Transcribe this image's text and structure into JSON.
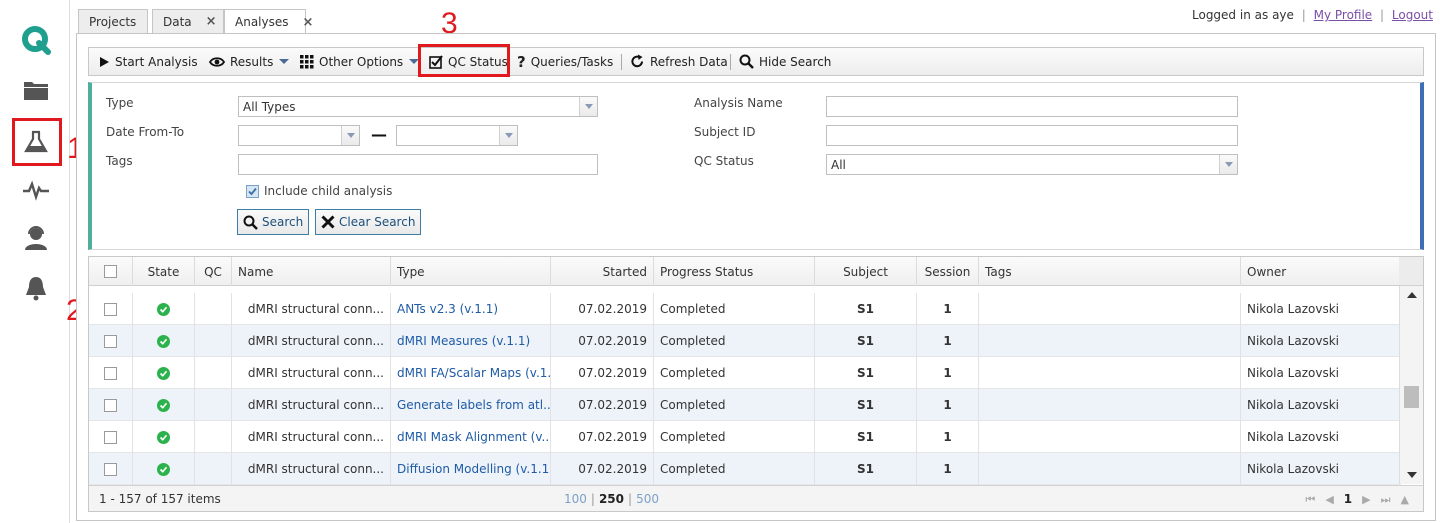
{
  "sidebar": {
    "items": [
      {
        "name": "logo",
        "icon": "q-logo-icon"
      },
      {
        "name": "projects",
        "icon": "folder-icon"
      },
      {
        "name": "analyses",
        "icon": "flask-icon"
      },
      {
        "name": "activity",
        "icon": "pulse-icon"
      },
      {
        "name": "support",
        "icon": "headset-user-icon"
      },
      {
        "name": "notifications",
        "icon": "bell-icon"
      }
    ],
    "accent": "#1fa08e"
  },
  "annotations": [
    "1",
    "2",
    "3"
  ],
  "tabs": [
    {
      "label": "Projects",
      "closable": false
    },
    {
      "label": "Data",
      "closable": true,
      "close": "×"
    },
    {
      "label": "Analyses",
      "closable": true,
      "close": "×",
      "active": true
    }
  ],
  "header": {
    "logged_in_as": "Logged in as",
    "user": "aye",
    "sep": "|",
    "my_profile": "My Profile",
    "logout": "Logout"
  },
  "toolbar": {
    "start_analysis": "Start Analysis",
    "results": "Results",
    "other_options": "Other Options",
    "qc_status": "QC Status",
    "queries_tasks": "Queries/Tasks",
    "refresh_data": "Refresh Data",
    "hide_search": "Hide Search"
  },
  "search": {
    "type_label": "Type",
    "type_value": "All Types",
    "date_label": "Date From-To",
    "date_dash": "—",
    "tags_label": "Tags",
    "include_child": "Include child analysis",
    "include_child_checked": true,
    "analysis_name_label": "Analysis Name",
    "subject_id_label": "Subject ID",
    "qc_status_label": "QC Status",
    "qc_status_value": "All",
    "search_button": "Search",
    "clear_button": "Clear Search"
  },
  "grid": {
    "columns": [
      "State",
      "QC",
      "Name",
      "Type",
      "Started",
      "Progress Status",
      "Subject",
      "Session",
      "Tags",
      "Owner"
    ],
    "rows": [
      {
        "name": "dMRI structural conn...",
        "type": "ANTs v2.3 (v.1.1)",
        "started": "07.02.2019",
        "progress": "Completed",
        "subject": "S1",
        "session": "1",
        "tags": "",
        "owner": "Nikola Lazovski"
      },
      {
        "name": "dMRI structural conn...",
        "type": "dMRI Measures (v.1.1)",
        "started": "07.02.2019",
        "progress": "Completed",
        "subject": "S1",
        "session": "1",
        "tags": "",
        "owner": "Nikola Lazovski"
      },
      {
        "name": "dMRI structural conn...",
        "type": "dMRI FA/Scalar Maps (v.1...",
        "started": "07.02.2019",
        "progress": "Completed",
        "subject": "S1",
        "session": "1",
        "tags": "",
        "owner": "Nikola Lazovski"
      },
      {
        "name": "dMRI structural conn...",
        "type": "Generate labels from atl...",
        "started": "07.02.2019",
        "progress": "Completed",
        "subject": "S1",
        "session": "1",
        "tags": "",
        "owner": "Nikola Lazovski"
      },
      {
        "name": "dMRI structural conn...",
        "type": "dMRI Mask Alignment (v....",
        "started": "07.02.2019",
        "progress": "Completed",
        "subject": "S1",
        "session": "1",
        "tags": "",
        "owner": "Nikola Lazovski"
      },
      {
        "name": "dMRI structural conn...",
        "type": "Diffusion Modelling (v.1.1)",
        "started": "07.02.2019",
        "progress": "Completed",
        "subject": "S1",
        "session": "1",
        "tags": "",
        "owner": "Nikola Lazovski"
      }
    ],
    "state_color": "#2bb24c",
    "type_link_color": "#1f5ba6"
  },
  "pager": {
    "items_text": "1 - 157 of 157 items",
    "sizes": [
      "100",
      "250",
      "500"
    ],
    "current_size": "250",
    "sep": "|",
    "page": "1"
  }
}
